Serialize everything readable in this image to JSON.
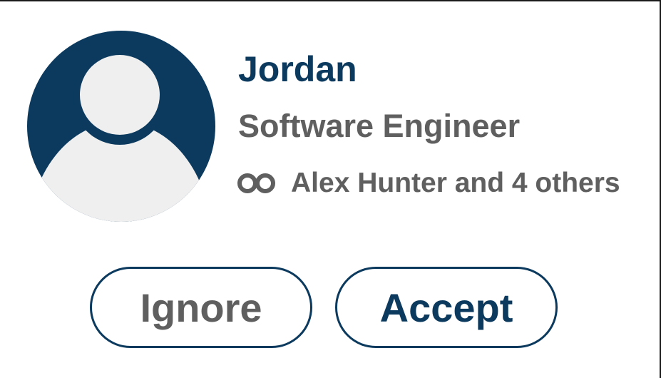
{
  "invitation": {
    "name": "Jordan",
    "headline": "Software Engineer",
    "mutual_connections": "Alex Hunter and 4 others",
    "avatar_icon": "default-person-avatar",
    "mutual_icon": "mutual-connections-icon"
  },
  "actions": {
    "ignore_label": "Ignore",
    "accept_label": "Accept"
  },
  "colors": {
    "brand_navy": "#0b3a5e",
    "text_gray": "#5f5f5f",
    "avatar_fill": "#efefef"
  }
}
